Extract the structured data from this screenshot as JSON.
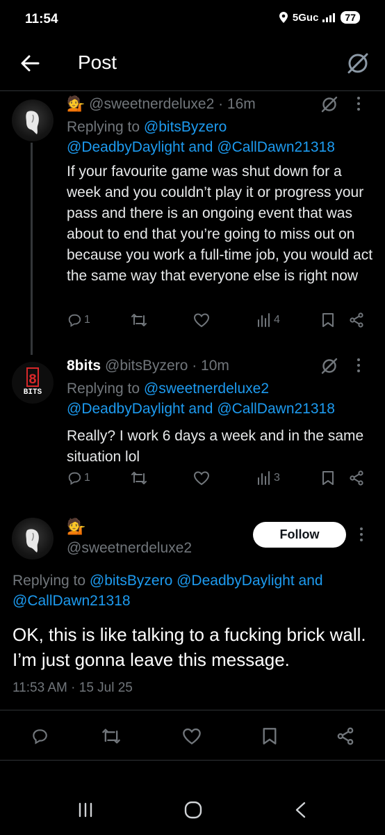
{
  "status_bar": {
    "time": "11:54",
    "network": "5Guc",
    "battery": "77"
  },
  "header": {
    "title": "Post"
  },
  "tweets": [
    {
      "emoji": "💁",
      "handle_time": "@sweetnerdeluxe2 · 16m",
      "replying_prefix": "Replying to",
      "replying_to_1": "@bitsByzero",
      "replying_to_2": "@DeadbyDaylight",
      "replying_and": "and",
      "replying_to_3": "@CallDawn21318",
      "text": "If your favourite game was shut down for a week and you couldn’t play it or progress your pass and there is an ongoing event that was about to end that you’re going to miss out on because you work a full-time job, you would act the same way that everyone else is right now",
      "replies": "1",
      "views": "4"
    },
    {
      "display_name": "8bits",
      "handle_time": "@bitsByzero · 10m",
      "replying_prefix": "Replying to",
      "replying_to_1": "@sweetnerdeluxe2",
      "replying_to_2": "@DeadbyDaylight",
      "replying_and": "and",
      "replying_to_3": "@CallDawn21318",
      "text": "Really? I work 6 days a week and in the same situation lol",
      "replies": "1",
      "views": "3",
      "avatar_text": "BITS",
      "avatar_digit": "8"
    }
  ],
  "main_post": {
    "emoji": "💁",
    "handle": "@sweetnerdeluxe2",
    "follow_label": "Follow",
    "replying_prefix": "Replying to",
    "replying_to_1": "@bitsByzero",
    "replying_to_2": "@DeadbyDaylight",
    "replying_and": "and",
    "replying_to_3": "@CallDawn21318",
    "text": "OK, this is like talking to a fucking brick wall. I’m just gonna leave this message.",
    "timestamp": "11:53 AM · 15 Jul 25"
  },
  "colors": {
    "link": "#1d9bf0",
    "muted": "#71767b",
    "background": "#000000"
  },
  "icons": [
    "back-arrow-icon",
    "grok-icon",
    "reply-icon",
    "retweet-icon",
    "like-icon",
    "views-icon",
    "bookmark-icon",
    "share-icon",
    "more-icon"
  ]
}
